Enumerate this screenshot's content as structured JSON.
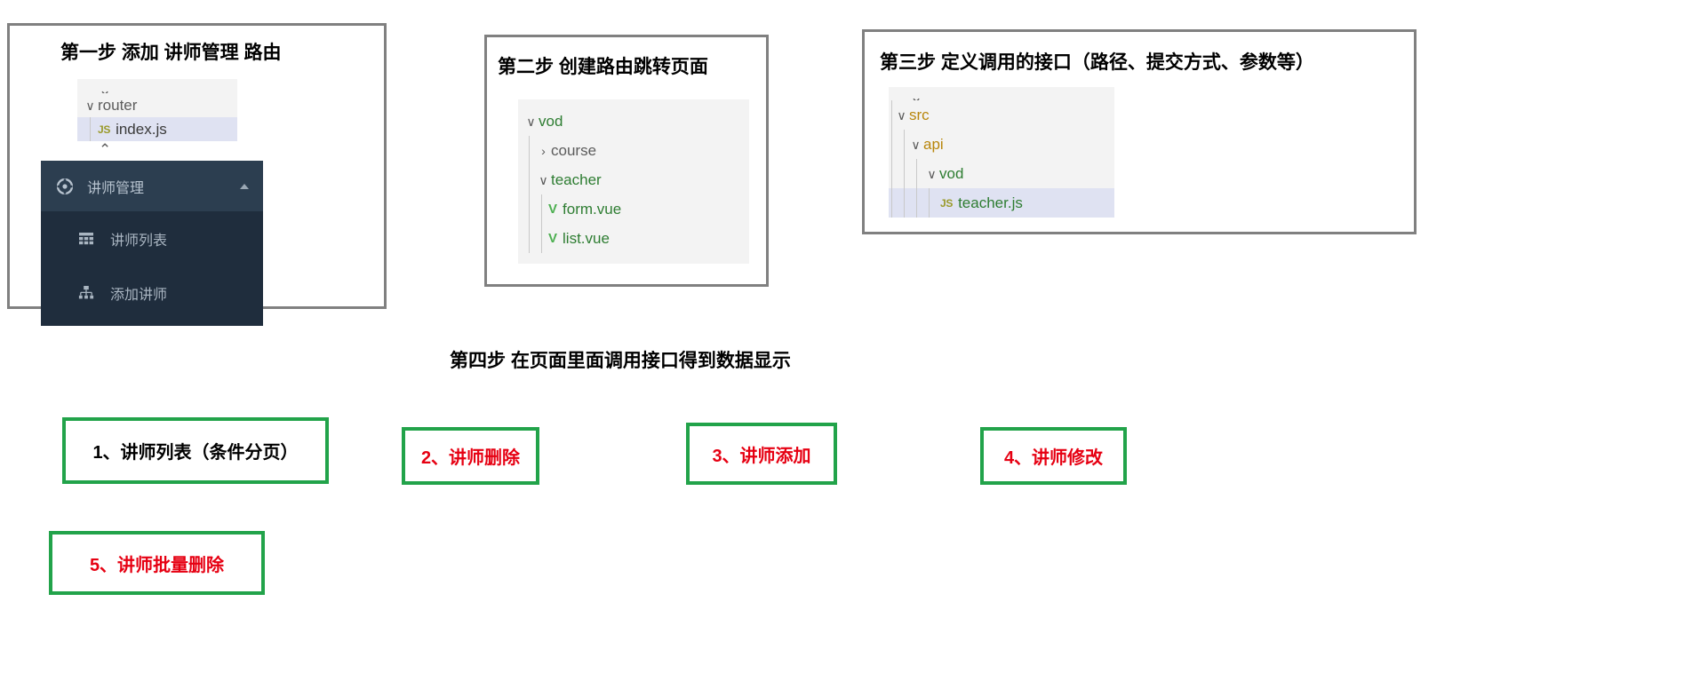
{
  "steps": {
    "step1": {
      "title": "第一步 添加 讲师管理 路由",
      "tree": {
        "partial_top": "",
        "nodes": [
          {
            "label": "router",
            "chevron": "∨",
            "kind": "folder",
            "selected": false
          },
          {
            "label": "index.js",
            "badge": "JS",
            "kind": "file-js",
            "selected": true
          }
        ]
      },
      "sidebar": {
        "header_label": "讲师管理",
        "header_icon": "compass-icon",
        "collapse_icon": "caret-up-icon",
        "items": [
          {
            "label": "讲师列表",
            "icon": "table-grid-icon"
          },
          {
            "label": "添加讲师",
            "icon": "sitemap-icon"
          }
        ]
      }
    },
    "step2": {
      "title": "第二步 创建路由跳转页面",
      "nodes": [
        {
          "label": "vod",
          "chevron": "∨",
          "color": "green",
          "indent": 0
        },
        {
          "label": "course",
          "chevron": "›",
          "color": "gray",
          "indent": 1
        },
        {
          "label": "teacher",
          "chevron": "∨",
          "color": "green",
          "indent": 1
        },
        {
          "label": "form.vue",
          "badge": "V",
          "color": "green",
          "indent": 2
        },
        {
          "label": "list.vue",
          "badge": "V",
          "color": "green",
          "indent": 2
        }
      ]
    },
    "step3": {
      "title": "第三步 定义调用的接口（路径、提交方式、参数等）",
      "nodes": [
        {
          "label": "src",
          "chevron": "∨",
          "color": "amber",
          "indent": 0
        },
        {
          "label": "api",
          "chevron": "∨",
          "color": "amber",
          "indent": 1
        },
        {
          "label": "vod",
          "chevron": "∨",
          "color": "green",
          "indent": 2
        },
        {
          "label": "teacher.js",
          "badge": "JS",
          "color": "green",
          "indent": 3,
          "selected": true
        }
      ]
    },
    "step4": {
      "title": "第四步 在页面里面调用接口得到数据显示"
    }
  },
  "tasks": [
    {
      "label": "1、讲师列表（条件分页）",
      "color": "#000000"
    },
    {
      "label": "2、讲师删除",
      "color": "#e60012"
    },
    {
      "label": "3、讲师添加",
      "color": "#e60012"
    },
    {
      "label": "4、讲师修改",
      "color": "#e60012"
    },
    {
      "label": "5、讲师批量删除",
      "color": "#e60012"
    }
  ],
  "colors": {
    "box_border_green": "#22a34a",
    "panel_border_gray": "#808080",
    "sidebar_header": "#2c3e50",
    "sidebar_body": "#1f2d3d",
    "selected_row": "#dfe2f2"
  }
}
